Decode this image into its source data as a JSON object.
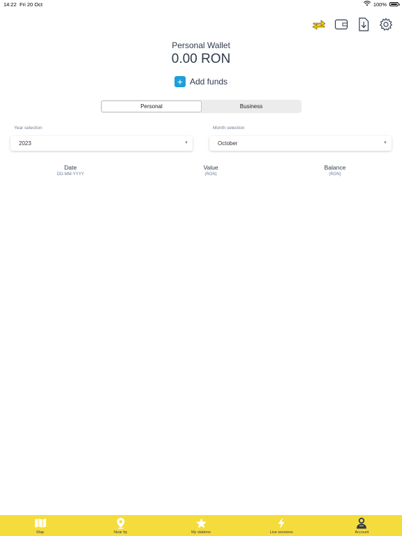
{
  "status_bar": {
    "time": "14:22",
    "date": "Fri 20 Oct",
    "battery": "100%"
  },
  "header_icons": [
    "exchange-icon",
    "wallet-icon",
    "download-document-icon",
    "gear-icon"
  ],
  "wallet": {
    "title": "Personal Wallet",
    "balance": "0.00 RON",
    "add_funds_label": "Add funds"
  },
  "segments": {
    "personal": "Personal",
    "business": "Business",
    "active": "Personal"
  },
  "filters": {
    "year_label": "Year selection",
    "year_value": "2023",
    "month_label": "Month selection",
    "month_value": "October"
  },
  "table": {
    "columns": [
      {
        "title": "Date",
        "sub": "DD-MM-YYYY"
      },
      {
        "title": "Value",
        "sub": "(RON)"
      },
      {
        "title": "Balance",
        "sub": "(RON)"
      }
    ],
    "rows": []
  },
  "tabs": [
    {
      "label": "Map",
      "icon": "map-icon"
    },
    {
      "label": "Near by",
      "icon": "location-pin-icon"
    },
    {
      "label": "My stations",
      "icon": "star-icon"
    },
    {
      "label": "Live sessions",
      "icon": "lightning-icon"
    },
    {
      "label": "Account",
      "icon": "user-icon"
    }
  ],
  "colors": {
    "accent": "#f5dc3d",
    "add_button": "#1e9fd8",
    "exchange_icon": "#f0c400",
    "text": "#2f3b4c"
  }
}
